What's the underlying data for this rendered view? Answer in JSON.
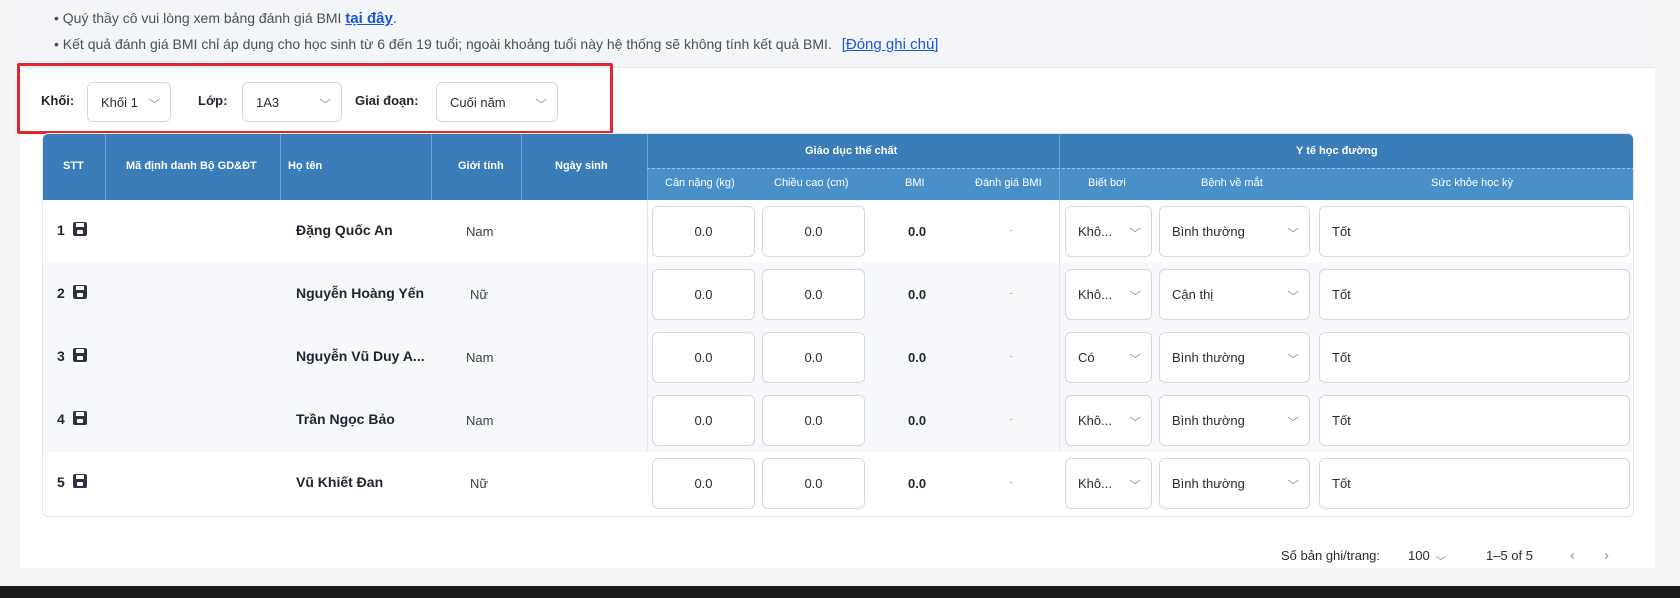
{
  "notes": {
    "line1_prefix": "• Quý thầy cô vui lòng xem bảng đánh giá BMI",
    "line1_link": "tại đây",
    "line1_suffix": ".",
    "line2_text": "• Kết quả đánh giá BMI chỉ áp dụng cho học sinh từ 6 đến 19 tuổi; ngoài khoảng tuổi này hệ thống sẽ không tính kết quả BMI.",
    "line2_link": "[Đóng ghi chú]"
  },
  "filters": {
    "grade_label": "Khối:",
    "grade_value": "Khối 1",
    "class_label": "Lớp:",
    "class_value": "1A3",
    "period_label": "Giai đoạn:",
    "period_value": "Cuối năm"
  },
  "table": {
    "headers": {
      "stt": "STT",
      "id": "Mã định danh Bộ GD&ĐT",
      "name": "Họ tên",
      "gender": "Giới tính",
      "dob": "Ngày sinh",
      "pe_group": "Giáo dục thể chất",
      "weight": "Cân nặng (kg)",
      "height": "Chiều cao (cm)",
      "bmi": "BMI",
      "bmi_eval": "Đánh giá BMI",
      "health_group": "Y tế học đường",
      "swim": "Biết bơi",
      "eye": "Bệnh về mắt",
      "semester_health": "Sức khỏe học kỳ"
    },
    "rows": [
      {
        "stt": "1",
        "name": "Đặng Quốc An",
        "gender": "Nam",
        "weight": "0.0",
        "height": "0.0",
        "bmi": "0.0",
        "bmi_eval": "-",
        "swim": "Khô...",
        "eye": "Bình thường",
        "health": "Tốt"
      },
      {
        "stt": "2",
        "name": "Nguyễn Hoàng Yến",
        "gender": "Nữ",
        "weight": "0.0",
        "height": "0.0",
        "bmi": "0.0",
        "bmi_eval": "-",
        "swim": "Khô...",
        "eye": "Cận thị",
        "health": "Tốt"
      },
      {
        "stt": "3",
        "name": "Nguyễn Vũ Duy A...",
        "gender": "Nam",
        "weight": "0.0",
        "height": "0.0",
        "bmi": "0.0",
        "bmi_eval": "-",
        "swim": "Có",
        "eye": "Bình thường",
        "health": "Tốt"
      },
      {
        "stt": "4",
        "name": "Trần Ngọc Bảo",
        "gender": "Nam",
        "weight": "0.0",
        "height": "0.0",
        "bmi": "0.0",
        "bmi_eval": "-",
        "swim": "Khô...",
        "eye": "Bình thường",
        "health": "Tốt"
      },
      {
        "stt": "5",
        "name": "Vũ Khiết Đan",
        "gender": "Nữ",
        "weight": "0.0",
        "height": "0.0",
        "bmi": "0.0",
        "bmi_eval": "-",
        "swim": "Khô...",
        "eye": "Bình thường",
        "health": "Tốt"
      }
    ]
  },
  "pagination": {
    "per_page_label": "Số bản ghi/trang:",
    "per_page_value": "100",
    "range": "1–5 of 5"
  },
  "icons": {
    "chevron_down": "⌵",
    "prev": "‹",
    "next": "›"
  }
}
